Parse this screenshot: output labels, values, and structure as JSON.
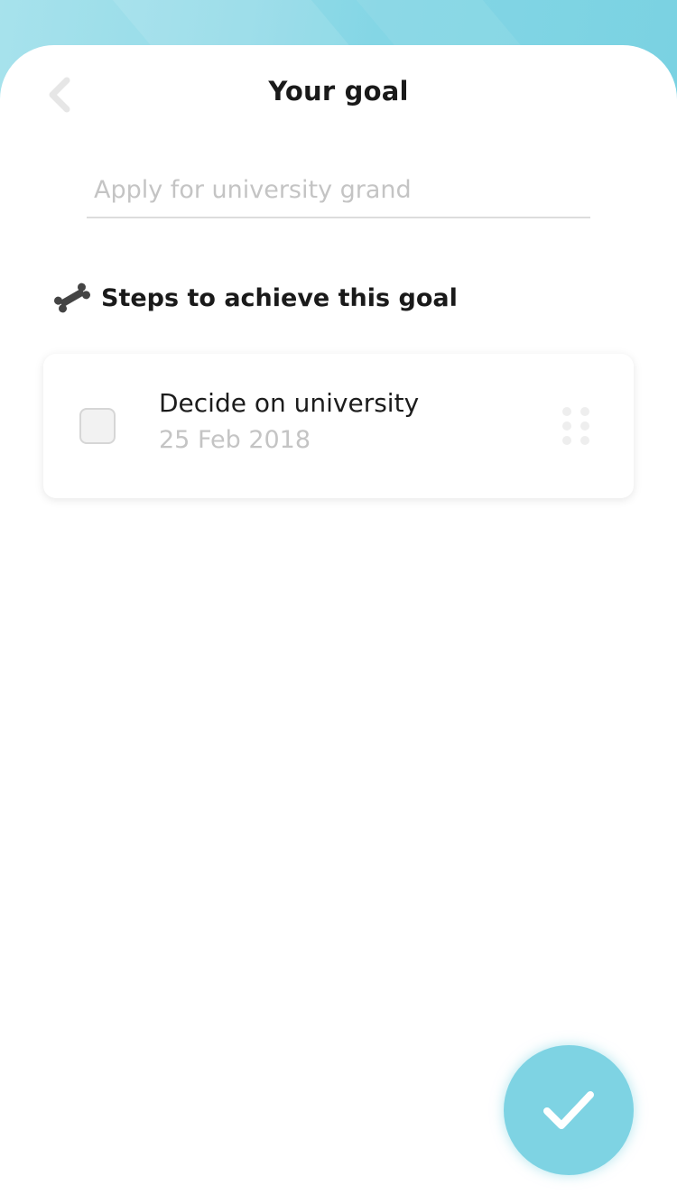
{
  "header": {
    "title": "Your goal"
  },
  "goal_input": {
    "value": "",
    "placeholder": "Apply for university grand"
  },
  "steps_section": {
    "title": "Steps to achieve this goal",
    "icon": "bone-icon"
  },
  "steps": [
    {
      "title": "Decide on university",
      "date": "25 Feb 2018",
      "checked": false
    }
  ],
  "colors": {
    "accent": "#7ed3e3",
    "title_text": "#1a1a1a",
    "muted_text": "#c4c4c4"
  },
  "icons": {
    "back": "chevron-left-icon",
    "drag": "drag-handle-icon",
    "confirm": "checkmark-icon"
  }
}
